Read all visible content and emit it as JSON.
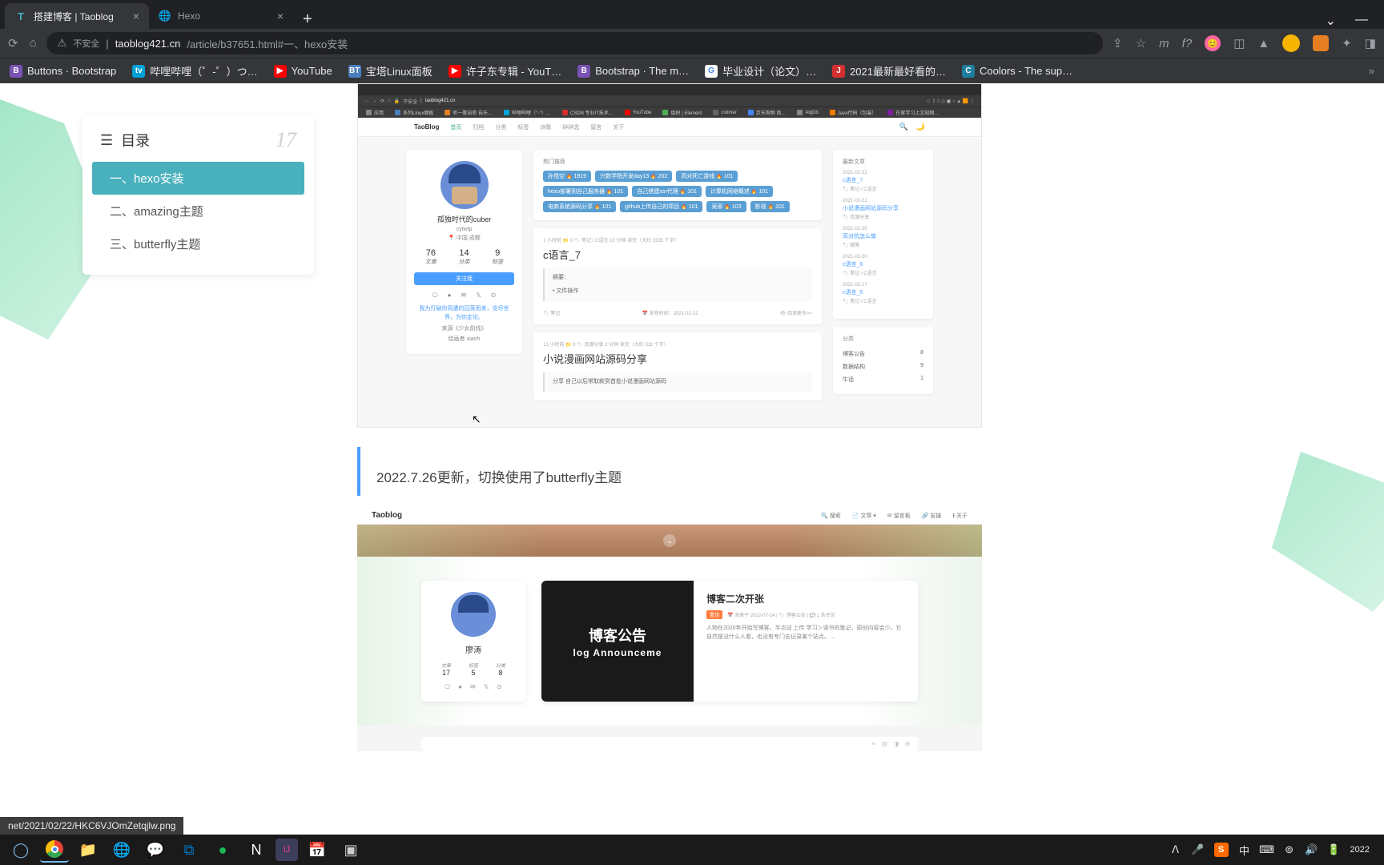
{
  "browser": {
    "tabs": [
      {
        "title": "搭建博客 | Taoblog",
        "favicon": "T"
      },
      {
        "title": "Hexo",
        "favicon": "🌐"
      }
    ],
    "url_insecure": "不安全",
    "url_host": "taoblog421.cn",
    "url_path": "/article/b37651.html#一、hexo安装",
    "bookmarks": [
      {
        "label": "Buttons · Bootstrap",
        "cls": "ico-b",
        "ico": "B"
      },
      {
        "label": "哔哩哔哩（゜-゜）つ…",
        "cls": "ico-bili",
        "ico": "tv"
      },
      {
        "label": "YouTube",
        "cls": "ico-yt",
        "ico": "▶"
      },
      {
        "label": "宝塔Linux面板",
        "cls": "ico-bt",
        "ico": "BT"
      },
      {
        "label": "许子东专辑 - YouT…",
        "cls": "ico-yt",
        "ico": "▶"
      },
      {
        "label": "Bootstrap · The m…",
        "cls": "ico-b",
        "ico": "B"
      },
      {
        "label": "毕业设计（论文）…",
        "cls": "ico-g",
        "ico": "G"
      },
      {
        "label": "2021最新最好看的…",
        "cls": "ico-j",
        "ico": "J"
      },
      {
        "label": "Coolors - The sup…",
        "cls": "ico-c",
        "ico": "C"
      }
    ]
  },
  "toc": {
    "title": "目录",
    "count": "17",
    "items": [
      {
        "label": "一、hexo安装",
        "active": true
      },
      {
        "label": "二、amazing主题",
        "active": false
      },
      {
        "label": "三、butterfly主题",
        "active": false
      }
    ]
  },
  "shot1": {
    "url": "taoblog421.cn",
    "insecure": "不安全",
    "bookmarks": [
      {
        "l": "应用",
        "c": "#888"
      },
      {
        "l": "系列Linux面板",
        "c": "#4a7fc1"
      },
      {
        "l": "听一歌自愈 自乐…",
        "c": "#e67e22"
      },
      {
        "l": "哔哩哔哩（°-°）…",
        "c": "#00a1d6"
      },
      {
        "l": "CSDN 专业IT技术…",
        "c": "#d32f2f"
      },
      {
        "l": "YouTube",
        "c": "#ff0000"
      },
      {
        "l": "组织 | Element",
        "c": "#4caf50"
      },
      {
        "l": "cstimer",
        "c": "#666"
      },
      {
        "l": "京东购物 商…",
        "c": "#4285f4"
      },
      {
        "l": "AlgDb",
        "c": "#888"
      },
      {
        "l": "Java代码（包装）",
        "c": "#f57c00"
      },
      {
        "l": "在家学习上文知网…",
        "c": "#7b1fa2"
      }
    ],
    "nav_logo": "TaoBlog",
    "nav": [
      "首页",
      "归档",
      "分类",
      "标签",
      "诗歌",
      "碎碎念",
      "留言",
      "关于"
    ],
    "profile": {
      "name": "孤独时代的cuber",
      "handle": "cytwtp",
      "location": "中国 成都",
      "stats": [
        {
          "label": "文章",
          "value": "76"
        },
        {
          "label": "分类",
          "value": "14"
        },
        {
          "label": "标签",
          "value": "9"
        }
      ],
      "follow": "关注我",
      "motto": "我为打破你周遭的囚笼而来，览尽世界，为你定论。",
      "from_label": "来源《少女前线》",
      "author": "绘画者 xiaoh"
    },
    "hot": {
      "title": "热门推荐",
      "tags": [
        {
          "l": "孙悟空",
          "n": "1919"
        },
        {
          "l": "兴数学院开发day13",
          "n": "202"
        },
        {
          "l": "高对死亡游戏",
          "n": "101"
        },
        {
          "l": "hexo部署到自己服务器",
          "n": "101"
        },
        {
          "l": "自己搭建ssr代理",
          "n": "101"
        },
        {
          "l": "计算机网络概述",
          "n": "101"
        },
        {
          "l": "电商系统源码分享",
          "n": "101"
        },
        {
          "l": "github上传自己的项目",
          "n": "101"
        },
        {
          "l": "吴邪",
          "n": "103"
        },
        {
          "l": "影视",
          "n": "101"
        }
      ]
    },
    "post1": {
      "meta": "1 小时前  📁 0  🏷 笔记 / C语言  10 分钟 读完（大约 1535 个字）",
      "title": "c语言_7",
      "excerpt_title": "摘要：",
      "excerpt": "文件操作",
      "tag": "🏷 笔记",
      "date": "📅 发布时间：2021-02-22",
      "more": "👁 阅读更多>>"
    },
    "post2": {
      "meta": "13 小时前  📁 0  🏷 资源分享  2 分钟 读完（大约 311 个字）",
      "title": "小说漫画网站源码分享",
      "excerpt": "分享  自己以后常取款到首批小说漫画网站源码"
    },
    "recent": {
      "title": "最新文章",
      "items": [
        {
          "date": "2021-02-22",
          "title": "c语言_7",
          "cat": "🏷 笔记 / C语言"
        },
        {
          "date": "2021-02-21",
          "title": "小说漫画网站源码分享",
          "cat": "🏷 资源分享"
        },
        {
          "date": "2021-02-20",
          "title": "高对抗怎么做",
          "cat": "🏷 随笔"
        },
        {
          "date": "2021-02-20",
          "title": "c语言_6",
          "cat": "🏷 笔记 / C语言"
        },
        {
          "date": "2021-02-17",
          "title": "c语言_5",
          "cat": "🏷 笔记 / C语言"
        }
      ]
    },
    "cats": {
      "title": "分类",
      "items": [
        {
          "name": "博客公告",
          "count": "8"
        },
        {
          "name": "数据结构",
          "count": "9"
        },
        {
          "name": "牛话",
          "count": "1"
        }
      ]
    }
  },
  "update_note": "2022.7.26更新，切换使用了butterfly主题",
  "shot2": {
    "logo": "Taoblog",
    "top_menu": [
      "🔍 搜索",
      "📄 文章 ▾",
      "✉ 留言板",
      "🔗 友链",
      "ℹ 关于"
    ],
    "profile": {
      "name": "廖涛",
      "stats": [
        {
          "label": "文章",
          "value": "17"
        },
        {
          "label": "标签",
          "value": "5"
        },
        {
          "label": "分类",
          "value": "8"
        }
      ]
    },
    "post": {
      "banner_cn": "博客公告",
      "banner_en": "log Announceme",
      "title": "博客二次开张",
      "top": "置顶",
      "meta": "📅 发表于 2022-07-24 | 🏷 博客公告 | 💬 1 条评论",
      "text": "人物在2020年开始写博客，半点站 上传  学习＞读书的笔记，原创内容会少。它自然是没什么人看，也没有专门去记录某个站点。…"
    }
  },
  "status_url": "net/2021/02/22/HKC6VJOmZetqjlw.png",
  "tray": {
    "clock": "2022"
  }
}
